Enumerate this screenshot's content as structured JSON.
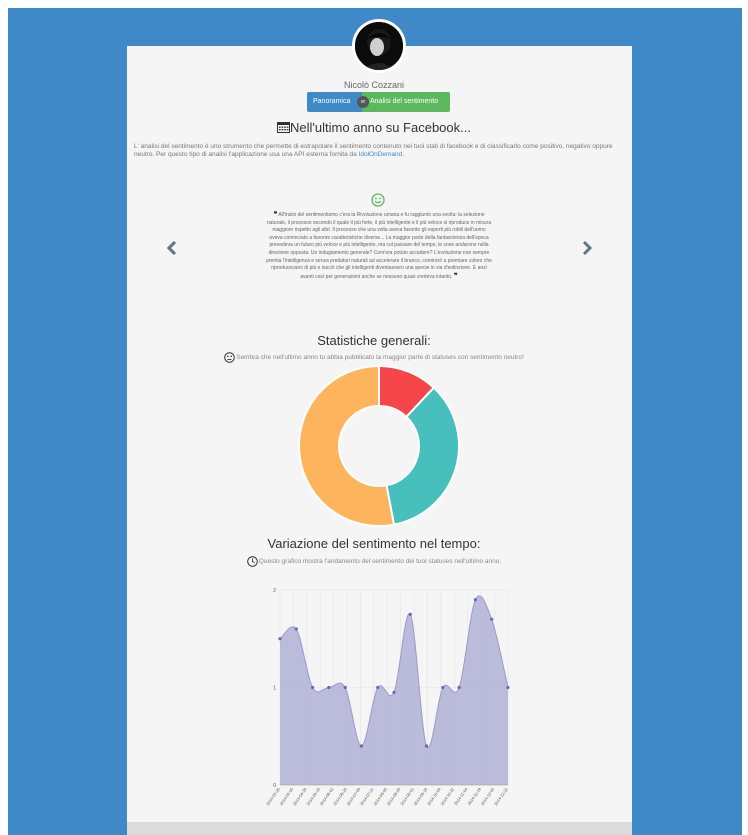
{
  "user": {
    "name": "Nicolò Cozzani"
  },
  "tabs": [
    {
      "label": "Panoramica"
    },
    {
      "label": "Analisi del sentimento"
    }
  ],
  "tab_separator": "or",
  "header": {
    "title": "Nell'ultimo anno su Facebook..."
  },
  "intro": {
    "text": "L' analisi del sentimento è uno strumento che permette di estrapolare il sentimento contenuto nei tuoi stati di facebook e di classificarlo come positivo, negativo oppure neutro. Per questo tipo di analisi l'applicazione usa una API esterna fornita da ",
    "link": "IdolOnDemand",
    "end": "."
  },
  "quote": {
    "text": "All'inizio del sentimentismo c'era la Rivoluzione umana e fu raggiunto una svolta: la selezione naturale, il processo secondo il quale il più forte, il più intelligente e il più veloce si riproduce in misura maggiore rispetto agli altri. Il processo che una volta aveva favorito gli esperti più robili dell'uomo aveva cominciato a favorire caratteristiche diverse... La maggior parte della fantascienza dell'epoca prevedeva un futuro più veloce e più intelligente, ma col passare del tempo, le cose andarono nella direzione opposta. Un indugiamento generale? Com'era potuto accadere? L'evoluzione non sempre premia l'intelligenza e senza predatori naturali ad accelerare il branco, cominciò a premiare coloro che riproducevano di più e lasciò che gli intelligenti diventassero una specie in via d'estinzione. E anzi avanti così per generazioni anche se nessuno quasi credeva intanto."
  },
  "stats": {
    "title": "Statistiche generali:",
    "caption": "Sembra che nell'ultimo anno tu abbia pubblicato la maggior parte di statuses con sentimento neutro!"
  },
  "variation": {
    "title": "Variazione del sentimento nel tempo:",
    "caption": "Questo grafico mostra l'andamento del sentimento dei tuoi statuses nell'ultimo anno."
  },
  "icons": {
    "calendar": "calendar-icon",
    "smile": "smile-icon",
    "neutral": "neutral-face-icon",
    "clock": "clock-icon",
    "prev": "chevron-left-icon",
    "next": "chevron-right-icon"
  },
  "colors": {
    "background_blue": "#3f89c9",
    "tab_blue": "#3f89c9",
    "tab_green": "#5cb85c",
    "doughnut_red": "#f7464a",
    "doughnut_teal": "#46bfbd",
    "doughnut_yellow": "#fdb45c",
    "area_fill": "#b0b0d6",
    "area_point": "#6a6ab0"
  },
  "chart_data": [
    {
      "type": "doughnut",
      "segments": [
        {
          "value": 12,
          "color": "#f7464a"
        },
        {
          "value": 35,
          "color": "#46bfbd"
        },
        {
          "value": 53,
          "color": "#fdb45c"
        }
      ]
    },
    {
      "type": "area",
      "categories": [
        "2014-03-20",
        "2014-04-05",
        "2014-04-28",
        "2014-05-10",
        "2014-06-02",
        "2014-06-24",
        "2014-07-09",
        "2014-07-21",
        "2014-08-05",
        "2014-08-20",
        "2014-09-01",
        "2014-09-18",
        "2014-10-04",
        "2014-10-22",
        "2014-11-04",
        "2014-11-19",
        "2014-12-03",
        "2014-12-22"
      ],
      "values": [
        1.5,
        1.6,
        1.0,
        1.0,
        1.0,
        0.4,
        1.0,
        0.95,
        1.75,
        0.4,
        1.0,
        1.0,
        1.9,
        1.7,
        1.0
      ],
      "yticks": [
        "0",
        "1",
        "2"
      ],
      "ylim": [
        0,
        2
      ]
    }
  ]
}
